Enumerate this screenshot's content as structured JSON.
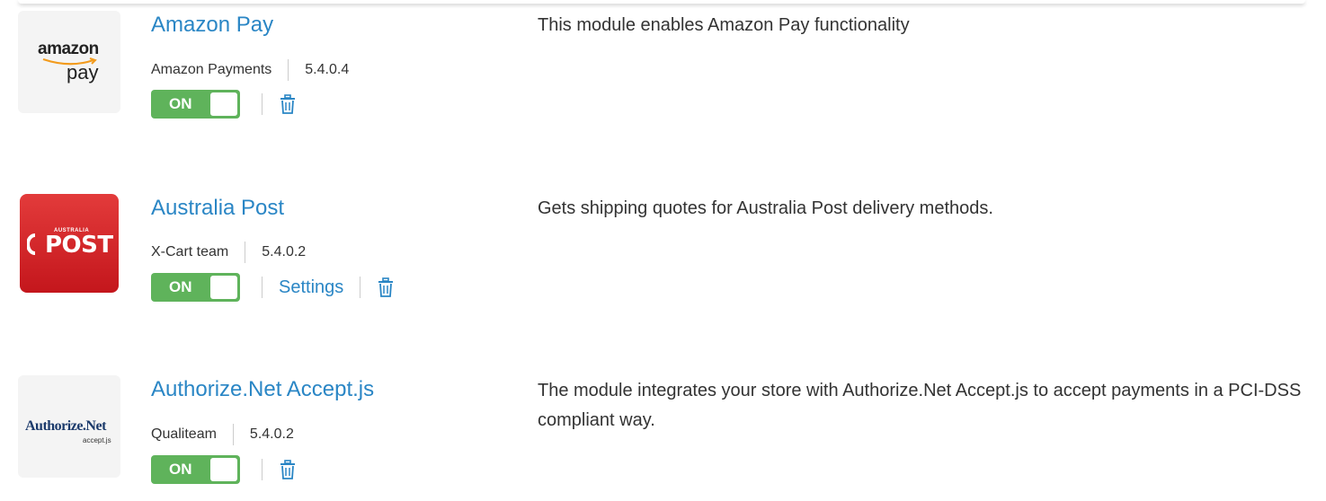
{
  "modules": [
    {
      "title": "Amazon Pay",
      "author": "Amazon Payments",
      "version": "5.4.0.4",
      "toggle_label": "ON",
      "description": "This module enables Amazon Pay functionality",
      "logo": {
        "line1": "amazon",
        "line2": "pay"
      },
      "has_settings": false
    },
    {
      "title": "Australia Post",
      "author": "X-Cart team",
      "version": "5.4.0.2",
      "toggle_label": "ON",
      "settings_label": "Settings",
      "description": "Gets shipping quotes for Australia Post delivery methods.",
      "logo": {
        "line1": "AUSTRALIA",
        "line2": "POST"
      },
      "has_settings": true
    },
    {
      "title": "Authorize.Net Accept.js",
      "author": "Qualiteam",
      "version": "5.4.0.2",
      "toggle_label": "ON",
      "description": "The module integrates your store with Authorize.Net Accept.js to accept payments in a PCI-DSS compliant way.",
      "logo": {
        "line1": "Authorize.Net",
        "line2": "accept.js"
      },
      "has_settings": false
    }
  ],
  "colors": {
    "link": "#2a86c5",
    "toggle_on": "#5fb35b",
    "post_red": "#c4161c"
  },
  "icons": [
    "trash-icon"
  ]
}
